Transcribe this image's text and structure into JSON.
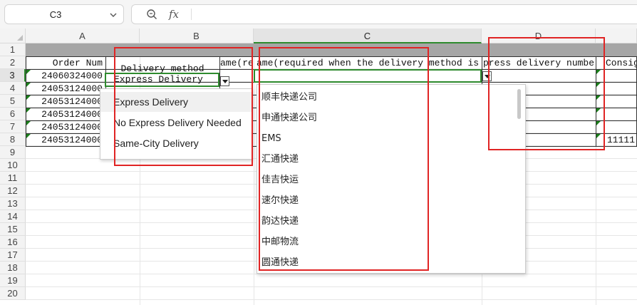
{
  "formula_bar": {
    "name_box": "C3",
    "fx_label": "fx",
    "formula_value": ""
  },
  "columns": [
    "A",
    "B",
    "C",
    "D"
  ],
  "rows": [
    "1",
    "2",
    "3",
    "4",
    "5",
    "6",
    "7",
    "8",
    "9",
    "10",
    "11",
    "12",
    "13",
    "14",
    "15",
    "16",
    "17",
    "18",
    "19",
    "20"
  ],
  "sheet": {
    "header_row": {
      "a": "Order Num",
      "b": "Delivery method",
      "b_overflow": "ame(re",
      "c": "ame(required when the delivery method is",
      "d": "press delivery numbe",
      "e": "Consig"
    },
    "a_values": [
      "24060324000",
      "24053124000",
      "24053124000",
      "24053124000",
      "24053124000",
      "24053124000"
    ],
    "b3_value": "Express Delivery",
    "e8_value": "11111"
  },
  "dropdown_b": {
    "options": [
      "Express Delivery",
      "No Express Delivery Needed",
      "Same-City Delivery"
    ]
  },
  "dropdown_c": {
    "options": [
      "顺丰快递公司",
      "申通快递公司",
      "EMS",
      "汇通快递",
      "佳吉快运",
      "速尔快递",
      "韵达快递",
      "中邮物流",
      "圆通快递"
    ]
  },
  "colors": {
    "selection": "#2e8b2e",
    "highlight_box": "#e02424",
    "header_band": "#a6a6a6"
  }
}
